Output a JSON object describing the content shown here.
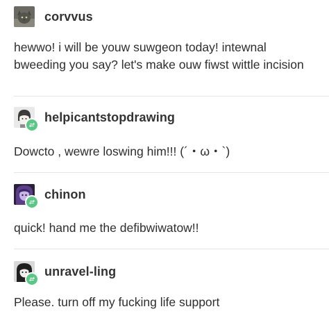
{
  "posts": [
    {
      "username": "corvvus",
      "avatar_icon": "cat-avatar-icon",
      "reblog": false,
      "text": "hewwo! i will be youw suwgeon today! intewnal bweeding you say? let's make ouw fiwst wittle incision"
    },
    {
      "username": "helpicantstopdrawing",
      "avatar_icon": "drawn-character-avatar-icon",
      "reblog": true,
      "text": "Dowcto , wewre loswing him!!! (´・ω・`)"
    },
    {
      "username": "chinon",
      "avatar_icon": "purple-character-avatar-icon",
      "reblog": true,
      "text": "quick! hand me the defibwiwatow!!"
    },
    {
      "username": "unravel-ling",
      "avatar_icon": "dark-character-avatar-icon",
      "reblog": true,
      "text": "Please. turn off my fucking life support"
    }
  ],
  "colors": {
    "reblog_badge": "#57c983",
    "username": "#333333",
    "text": "#2e2e2e",
    "divider": "#e4e4e4"
  }
}
